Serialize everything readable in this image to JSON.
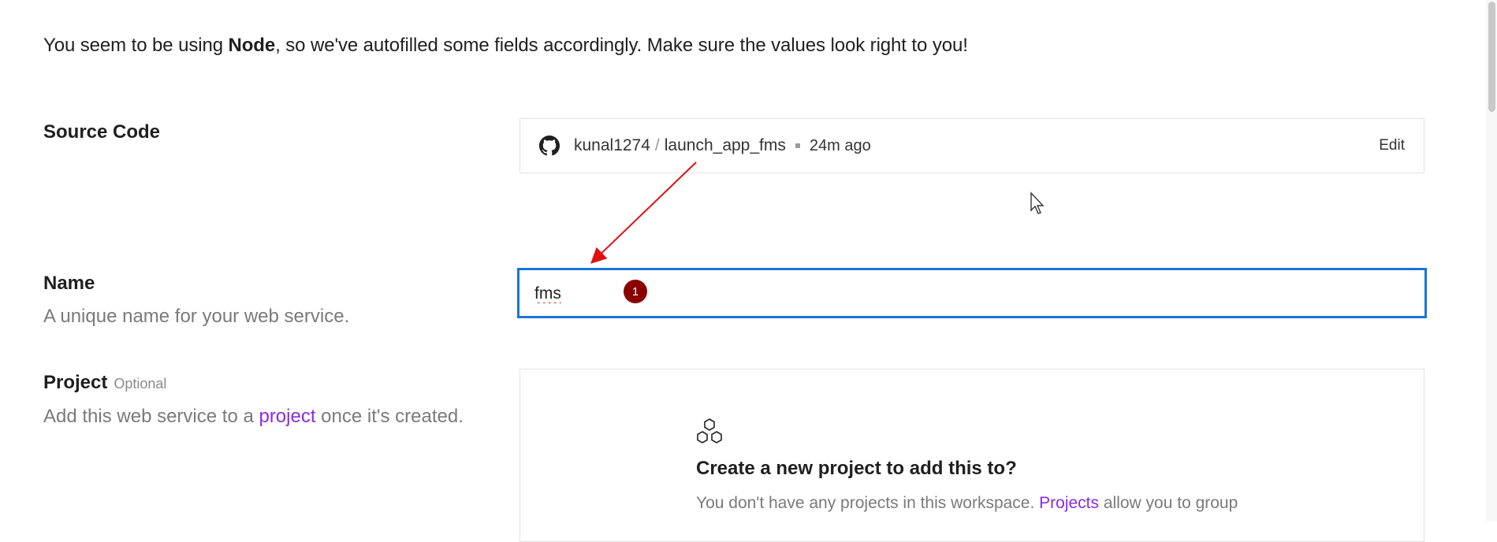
{
  "notice": {
    "prefix": "You seem to be using ",
    "runtime": "Node",
    "suffix": ", so we've autofilled some fields accordingly. Make sure the values look right to you!"
  },
  "source_code": {
    "label": "Source Code",
    "owner": "kunal1274",
    "separator": "/",
    "repo": "launch_app_fms",
    "updated": "24m ago",
    "edit_label": "Edit",
    "icon": "github-icon"
  },
  "name": {
    "label": "Name",
    "help": "A unique name for your web service.",
    "value": "fms",
    "step_badge": "1"
  },
  "project": {
    "label": "Project",
    "optional": "Optional",
    "help_prefix": "Add this web service to a ",
    "help_link": "project",
    "help_suffix": " once it's created.",
    "empty_title": "Create a new project to add this to?",
    "empty_desc_prefix": "You don't have any projects in this workspace. ",
    "empty_desc_link": "Projects",
    "empty_desc_suffix": " allow you to group",
    "icon": "hexagons-icon"
  },
  "colors": {
    "accent_link": "#8a2be2",
    "focus_border": "#1976d2",
    "annotation_red": "#e01010",
    "badge": "#8b0000"
  }
}
